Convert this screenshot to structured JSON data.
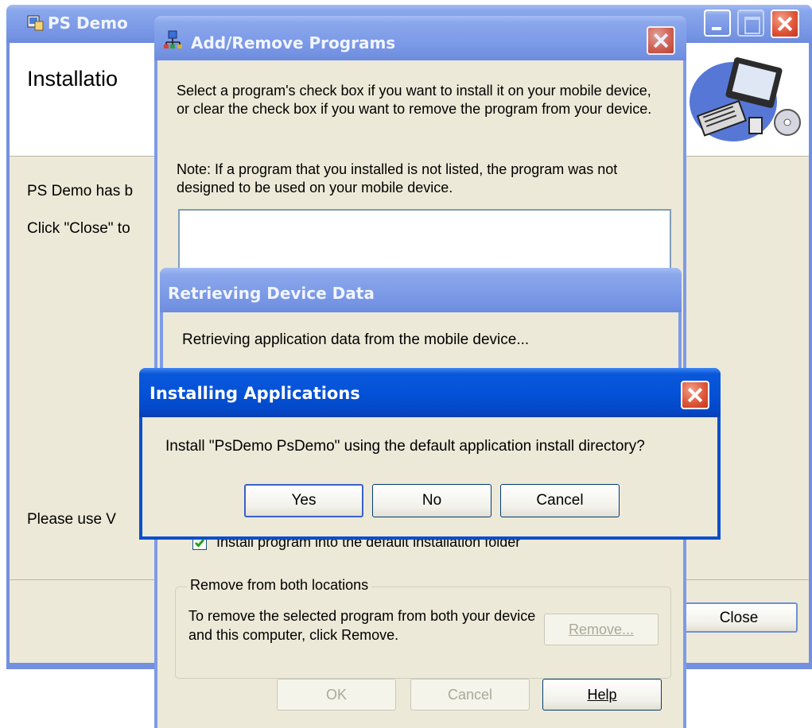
{
  "ps_demo": {
    "title": "PS Demo",
    "header_title": "Installatio",
    "line1": "PS Demo has b",
    "line2": "Click \"Close\" to",
    "line3": "Please use V",
    "close_button": "Close"
  },
  "add_remove": {
    "title": "Add/Remove Programs",
    "instructions": "Select a program's check box if you want to install it on your mobile device, or clear the check box if you want to remove the program from your device.",
    "note": "Note:  If a program that you installed is not listed, the program was not designed to be used on your mobile device.",
    "checkbox_label": "Install program into the default installation folder",
    "checkbox_checked": true,
    "group_title": "Remove from both locations",
    "group_text": "To remove the selected program from both your device and this computer, click Remove.",
    "remove_button": "Remove...",
    "ok_button": "OK",
    "cancel_button": "Cancel",
    "help_button": "Help"
  },
  "retrieving": {
    "title": "Retrieving Device Data",
    "message": "Retrieving application data from the mobile device..."
  },
  "installing": {
    "title": "Installing Applications",
    "message": "Install \"PsDemo PsDemo\" using the default application install directory?",
    "yes_button": "Yes",
    "no_button": "No",
    "cancel_button": "Cancel"
  }
}
